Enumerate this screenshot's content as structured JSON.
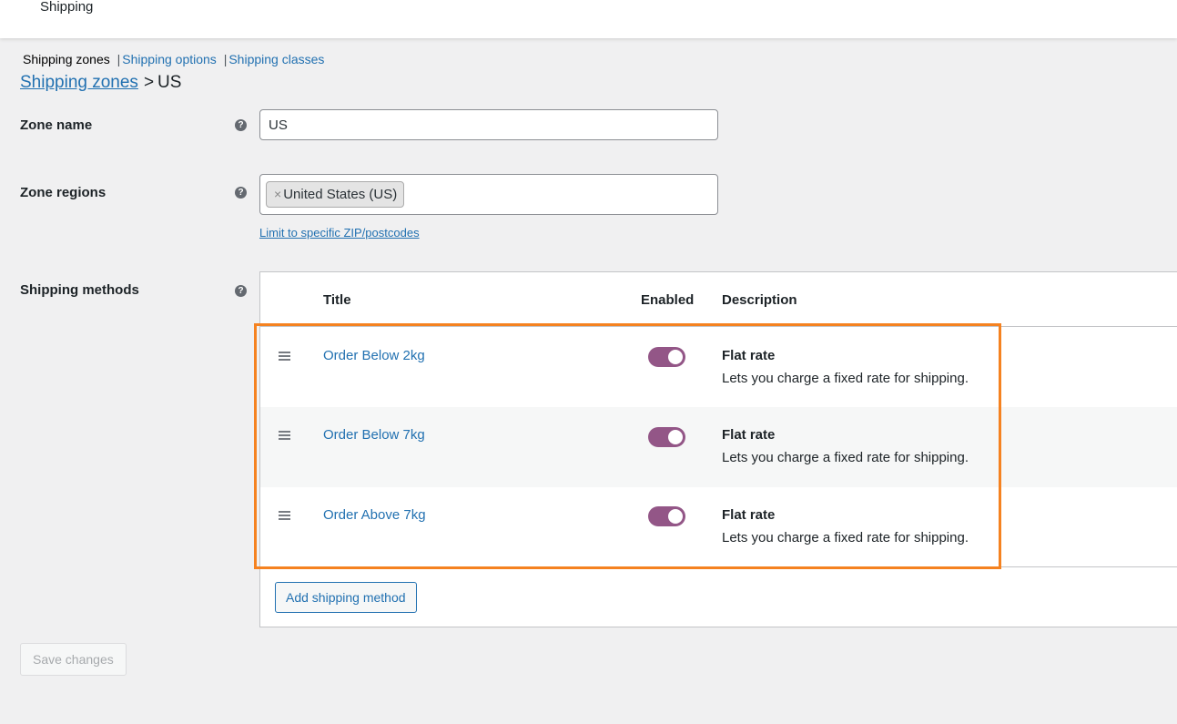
{
  "header": {
    "title": "Shipping"
  },
  "subnav": {
    "current": "Shipping zones",
    "links": [
      "Shipping options",
      "Shipping classes"
    ],
    "separator": "|"
  },
  "breadcrumb": {
    "link": "Shipping zones",
    "separator": ">",
    "current": "US"
  },
  "zone_name": {
    "label": "Zone name",
    "value": "US",
    "help": "?"
  },
  "zone_regions": {
    "label": "Zone regions",
    "help": "?",
    "chips": [
      {
        "remove": "×",
        "label": "United States (US)"
      }
    ],
    "limit_link": "Limit to specific ZIP/postcodes"
  },
  "shipping_methods": {
    "label": "Shipping methods",
    "help": "?",
    "columns": {
      "title": "Title",
      "enabled": "Enabled",
      "description": "Description"
    },
    "rows": [
      {
        "title": "Order Below 2kg",
        "enabled": true,
        "method": "Flat rate",
        "description": "Lets you charge a fixed rate for shipping."
      },
      {
        "title": "Order Below 7kg",
        "enabled": true,
        "method": "Flat rate",
        "description": "Lets you charge a fixed rate for shipping."
      },
      {
        "title": "Order Above 7kg",
        "enabled": true,
        "method": "Flat rate",
        "description": "Lets you charge a fixed rate for shipping."
      }
    ],
    "add_button": "Add shipping method"
  },
  "save_button": "Save changes",
  "colors": {
    "link": "#2271b1",
    "toggle_on": "#935687",
    "highlight": "#f58220",
    "background": "#f0f0f1"
  }
}
